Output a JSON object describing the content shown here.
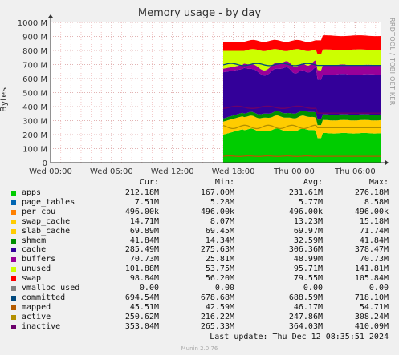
{
  "title": "Memory usage - by day",
  "side_text": "RRDTOOL / TOBI OETIKER",
  "columns": {
    "cur": "Cur:",
    "min": "Min:",
    "avg": "Avg:",
    "max": "Max:"
  },
  "last_update": "Last update:  Thu Dec 12 08:35:51 2024",
  "footer": "Munin 2.0.76",
  "chart_data": {
    "type": "area",
    "title": "Memory usage - by day",
    "ylabel": "Bytes",
    "ylim": [
      0,
      1000000000
    ],
    "yticks": [
      "0",
      "100 M",
      "200 M",
      "300 M",
      "400 M",
      "500 M",
      "600 M",
      "700 M",
      "800 M",
      "900 M",
      "1000 M"
    ],
    "xticks": [
      "Wed 00:00",
      "Wed 06:00",
      "Wed 12:00",
      "Wed 18:00",
      "Thu 00:00",
      "Thu 06:00"
    ],
    "grid": true,
    "data_start": "Wed 17:00",
    "series": [
      {
        "name": "apps",
        "color": "#00cc00",
        "cur": "212.18M",
        "min": "167.00M",
        "avg": "231.61M",
        "max": "276.18M"
      },
      {
        "name": "page_tables",
        "color": "#0066b3",
        "cur": "7.51M",
        "min": "5.28M",
        "avg": "5.77M",
        "max": "8.58M"
      },
      {
        "name": "per_cpu",
        "color": "#ff8000",
        "cur": "496.00k",
        "min": "496.00k",
        "avg": "496.00k",
        "max": "496.00k"
      },
      {
        "name": "swap_cache",
        "color": "#ffcc00",
        "cur": "14.71M",
        "min": "8.07M",
        "avg": "13.23M",
        "max": "15.18M"
      },
      {
        "name": "slab_cache",
        "color": "#ffcc00",
        "cur": "69.89M",
        "min": "69.45M",
        "avg": "69.97M",
        "max": "71.74M"
      },
      {
        "name": "shmem",
        "color": "#008f00",
        "cur": "41.84M",
        "min": "14.34M",
        "avg": "32.59M",
        "max": "41.84M"
      },
      {
        "name": "cache",
        "color": "#330099",
        "cur": "285.49M",
        "min": "275.63M",
        "avg": "306.36M",
        "max": "378.47M"
      },
      {
        "name": "buffers",
        "color": "#990099",
        "cur": "70.73M",
        "min": "25.81M",
        "avg": "48.99M",
        "max": "70.73M"
      },
      {
        "name": "unused",
        "color": "#ccff00",
        "cur": "101.88M",
        "min": "53.75M",
        "avg": "95.71M",
        "max": "141.81M"
      },
      {
        "name": "swap",
        "color": "#ff0000",
        "cur": "98.84M",
        "min": "56.20M",
        "avg": "79.55M",
        "max": "105.84M"
      },
      {
        "name": "vmalloc_used",
        "color": "#808080",
        "cur": "0.00",
        "min": "0.00",
        "avg": "0.00",
        "max": "0.00"
      },
      {
        "name": "committed",
        "color": "#00487d",
        "cur": "694.54M",
        "min": "678.68M",
        "avg": "688.59M",
        "max": "718.10M"
      },
      {
        "name": "mapped",
        "color": "#b35a00",
        "cur": "45.51M",
        "min": "42.59M",
        "avg": "46.17M",
        "max": "54.71M"
      },
      {
        "name": "active",
        "color": "#b38f00",
        "cur": "250.62M",
        "min": "216.22M",
        "avg": "247.86M",
        "max": "308.24M"
      },
      {
        "name": "inactive",
        "color": "#6b006b",
        "cur": "353.04M",
        "min": "265.33M",
        "avg": "364.03M",
        "max": "410.09M"
      }
    ]
  }
}
